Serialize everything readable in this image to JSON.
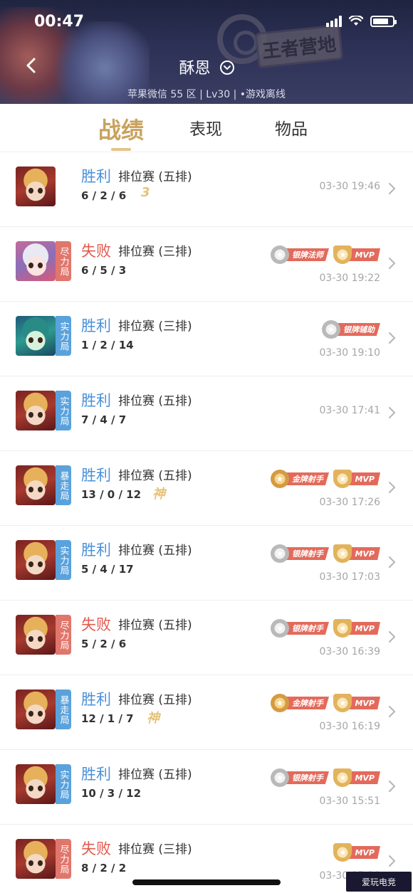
{
  "status_bar": {
    "time": "00:47"
  },
  "header": {
    "player_name": "酥恩",
    "server_info": "苹果微信 55 区 | Lv30 | •游戏离线",
    "sign_text": "王者营地"
  },
  "tabs": [
    {
      "label": "战绩",
      "active": true
    },
    {
      "label": "表现",
      "active": false
    },
    {
      "label": "物品",
      "active": false
    }
  ],
  "matches": [
    {
      "hero": "hero-a",
      "mode_tag": "",
      "tag_color": "",
      "result": "胜利",
      "result_type": "win",
      "mode": "排位赛 (五排)",
      "kda": "6 / 2 / 6",
      "badge": "3",
      "medals": [],
      "time": "03-30 19:46"
    },
    {
      "hero": "hero-b",
      "mode_tag": "尽力局",
      "tag_color": "red",
      "result": "失败",
      "result_type": "loss",
      "mode": "排位赛 (三排)",
      "kda": "6 / 5 / 3",
      "badge": "",
      "medals": [
        {
          "type": "silver",
          "label": "银牌法师"
        },
        {
          "type": "mvp",
          "label": "MVP"
        }
      ],
      "time": "03-30 19:22"
    },
    {
      "hero": "hero-c",
      "mode_tag": "实力局",
      "tag_color": "blue",
      "result": "胜利",
      "result_type": "win",
      "mode": "排位赛 (三排)",
      "kda": "1 / 2 / 14",
      "badge": "",
      "medals": [
        {
          "type": "silver",
          "label": "银牌辅助"
        }
      ],
      "time": "03-30 19:10"
    },
    {
      "hero": "hero-a",
      "mode_tag": "实力局",
      "tag_color": "blue",
      "result": "胜利",
      "result_type": "win",
      "mode": "排位赛 (五排)",
      "kda": "7 / 4 / 7",
      "badge": "",
      "medals": [],
      "time": "03-30 17:41"
    },
    {
      "hero": "hero-a",
      "mode_tag": "暴走局",
      "tag_color": "blue",
      "result": "胜利",
      "result_type": "win",
      "mode": "排位赛 (五排)",
      "kda": "13 / 0 / 12",
      "badge": "神",
      "medals": [
        {
          "type": "gold",
          "label": "金牌射手"
        },
        {
          "type": "mvp",
          "label": "MVP"
        }
      ],
      "time": "03-30 17:26"
    },
    {
      "hero": "hero-a",
      "mode_tag": "实力局",
      "tag_color": "blue",
      "result": "胜利",
      "result_type": "win",
      "mode": "排位赛 (五排)",
      "kda": "5 / 4 / 17",
      "badge": "",
      "medals": [
        {
          "type": "silver",
          "label": "银牌射手"
        },
        {
          "type": "mvp",
          "label": "MVP"
        }
      ],
      "time": "03-30 17:03"
    },
    {
      "hero": "hero-a",
      "mode_tag": "尽力局",
      "tag_color": "red",
      "result": "失败",
      "result_type": "loss",
      "mode": "排位赛 (五排)",
      "kda": "5 / 2 / 6",
      "badge": "",
      "medals": [
        {
          "type": "silver",
          "label": "银牌射手"
        },
        {
          "type": "mvp",
          "label": "MVP"
        }
      ],
      "time": "03-30 16:39"
    },
    {
      "hero": "hero-a",
      "mode_tag": "暴走局",
      "tag_color": "blue",
      "result": "胜利",
      "result_type": "win",
      "mode": "排位赛 (五排)",
      "kda": "12 / 1 / 7",
      "badge": "神",
      "medals": [
        {
          "type": "gold",
          "label": "金牌射手"
        },
        {
          "type": "mvp",
          "label": "MVP"
        }
      ],
      "time": "03-30 16:19"
    },
    {
      "hero": "hero-a",
      "mode_tag": "实力局",
      "tag_color": "blue",
      "result": "胜利",
      "result_type": "win",
      "mode": "排位赛 (五排)",
      "kda": "10 / 3 / 12",
      "badge": "",
      "medals": [
        {
          "type": "silver",
          "label": "银牌射手"
        },
        {
          "type": "mvp",
          "label": "MVP"
        }
      ],
      "time": "03-30 15:51"
    },
    {
      "hero": "hero-a",
      "mode_tag": "尽力局",
      "tag_color": "red",
      "result": "失败",
      "result_type": "loss",
      "mode": "排位赛 (三排)",
      "kda": "8 / 2 / 2",
      "badge": "",
      "medals": [
        {
          "type": "mvp",
          "label": "MVP"
        }
      ],
      "time": "03-30 15:30"
    }
  ],
  "watermark": "爱玩电竞",
  "colors": {
    "win": "#4a90d9",
    "loss": "#e25a4f",
    "tab_active": "#c9a25e",
    "tag_red": "#e0766c",
    "tag_blue": "#5aa2dc"
  }
}
